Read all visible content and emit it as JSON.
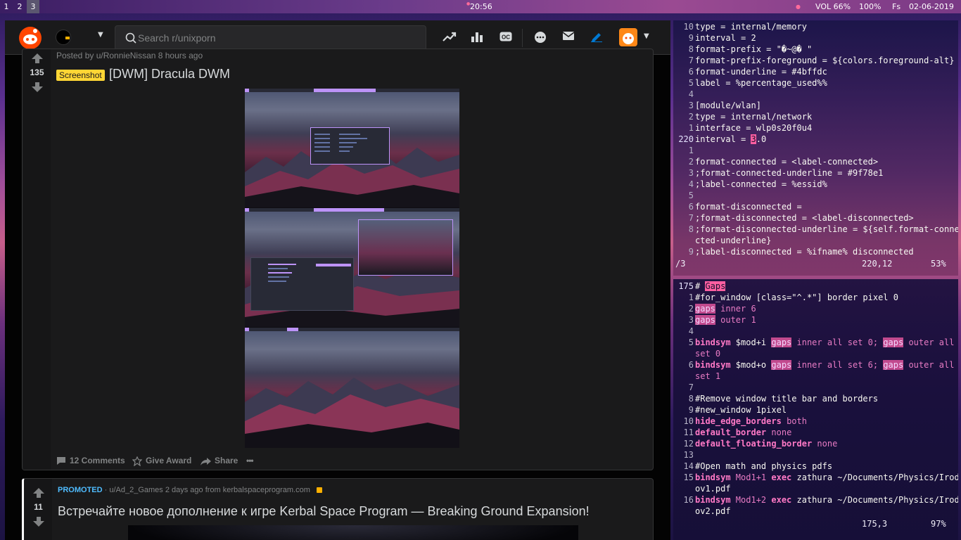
{
  "topbar": {
    "workspaces": [
      "1",
      "2",
      "3"
    ],
    "active_workspace": 2,
    "clock": "20:56",
    "volume": "VOL 66%",
    "battery": "100%",
    "layout": "Fs",
    "date": "02-06-2019"
  },
  "reddit": {
    "search_placeholder": "Search r/unixporn",
    "post1": {
      "meta": "Posted by u/RonnieNissan 8 hours ago",
      "score": "135",
      "flair": "Screenshot",
      "title": "[DWM] Dracula DWM",
      "comments": "12 Comments",
      "award": "Give Award",
      "share": "Share",
      "more": "•••"
    },
    "post2": {
      "promoted": "PROMOTED",
      "meta": "· u/Ad_2_Games 2 days ago from kerbalspaceprogram.com",
      "score": "11",
      "title": "Встречайте новое дополнение к игре Kerbal Space Program — Breaking Ground Expansion!"
    }
  },
  "vim1": {
    "lines": [
      {
        "n": "10",
        "t": "type = internal/memory"
      },
      {
        "n": "9",
        "t": "interval = 2"
      },
      {
        "n": "8",
        "t": "format-prefix = \"�~@� \""
      },
      {
        "n": "7",
        "t": "format-prefix-foreground = ${colors.foreground-alt}"
      },
      {
        "n": "6",
        "t": "format-underline = #4bffdc"
      },
      {
        "n": "5",
        "t": "label = %percentage_used%%"
      },
      {
        "n": "4",
        "t": ""
      },
      {
        "n": "3",
        "t": "[module/wlan]"
      },
      {
        "n": "2",
        "t": "type = internal/network"
      },
      {
        "n": "1",
        "t": "interface = wlp0s20f0u4"
      },
      {
        "n": "220",
        "t": "interval = ",
        "cursor": "3",
        "after": ".0"
      },
      {
        "n": "1",
        "t": ""
      },
      {
        "n": "2",
        "t": "format-connected = <label-connected>"
      },
      {
        "n": "3",
        "t": ";format-connected-underline = #9f78e1"
      },
      {
        "n": "4",
        "t": ";label-connected = %essid%"
      },
      {
        "n": "5",
        "t": ""
      },
      {
        "n": "6",
        "t": "format-disconnected ="
      },
      {
        "n": "7",
        "t": ";format-disconnected = <label-disconnected>"
      },
      {
        "n": "8",
        "t": ";format-disconnected-underline = ${self.format-conne"
      },
      {
        "n": "",
        "t": "cted-underline}"
      },
      {
        "n": "9",
        "t": ";label-disconnected = %ifname% disconnected"
      }
    ],
    "status_left": "/3",
    "status_pos": "220,12",
    "status_pct": "53%"
  },
  "vim2": {
    "status_pos": "175,3",
    "status_pct": "97%",
    "tokens": {
      "gaps": "gaps",
      "gaps_cap": "Gaps",
      "hash": "# ",
      "bindsym": "bindsym",
      "exec": "exec",
      "hide": "hide_edge_borders",
      "default_border": "default_border",
      "default_floating": "default_floating_border",
      "none": "none",
      "both": "both",
      "inner6": " inner 6",
      "outer1": " outer 1",
      "modi": " $mod+i ",
      "modo": " $mod+o ",
      "inner_all_0": " inner all set 0; ",
      "inner_all_6": " inner all set 6; ",
      "outer_all": " outer all",
      "set0": "set 0",
      "set1": "set 1",
      "forwin": "#for_window [class=\"^.*\"] border pixel 0",
      "remove": "#Remove window title bar and borders",
      "newwin": "#new_window 1pixel",
      "openmath": "#Open math and physics pdfs",
      "mod11": " Mod1+1 ",
      "mod12": " Mod1+2 ",
      "zath1a": " zathura ~/Documents/Physics/Irod",
      "zath1b": "ov1.pdf",
      "zath2a": " zathura ~/Documents/Physics/Irod",
      "zath2b": "ov2.pdf"
    },
    "nums": [
      "175",
      "1",
      "2",
      "3",
      "4",
      "5",
      "",
      "6",
      "",
      "7",
      "8",
      "9",
      "10",
      "11",
      "12",
      "13",
      "14",
      "15",
      "",
      "16",
      ""
    ]
  },
  "colors": {
    "reddit_orange": "#ff4500",
    "flair_yellow": "#ffd635",
    "vim_pink": "#ff79c6",
    "dracula_purple": "#bd93f9"
  }
}
